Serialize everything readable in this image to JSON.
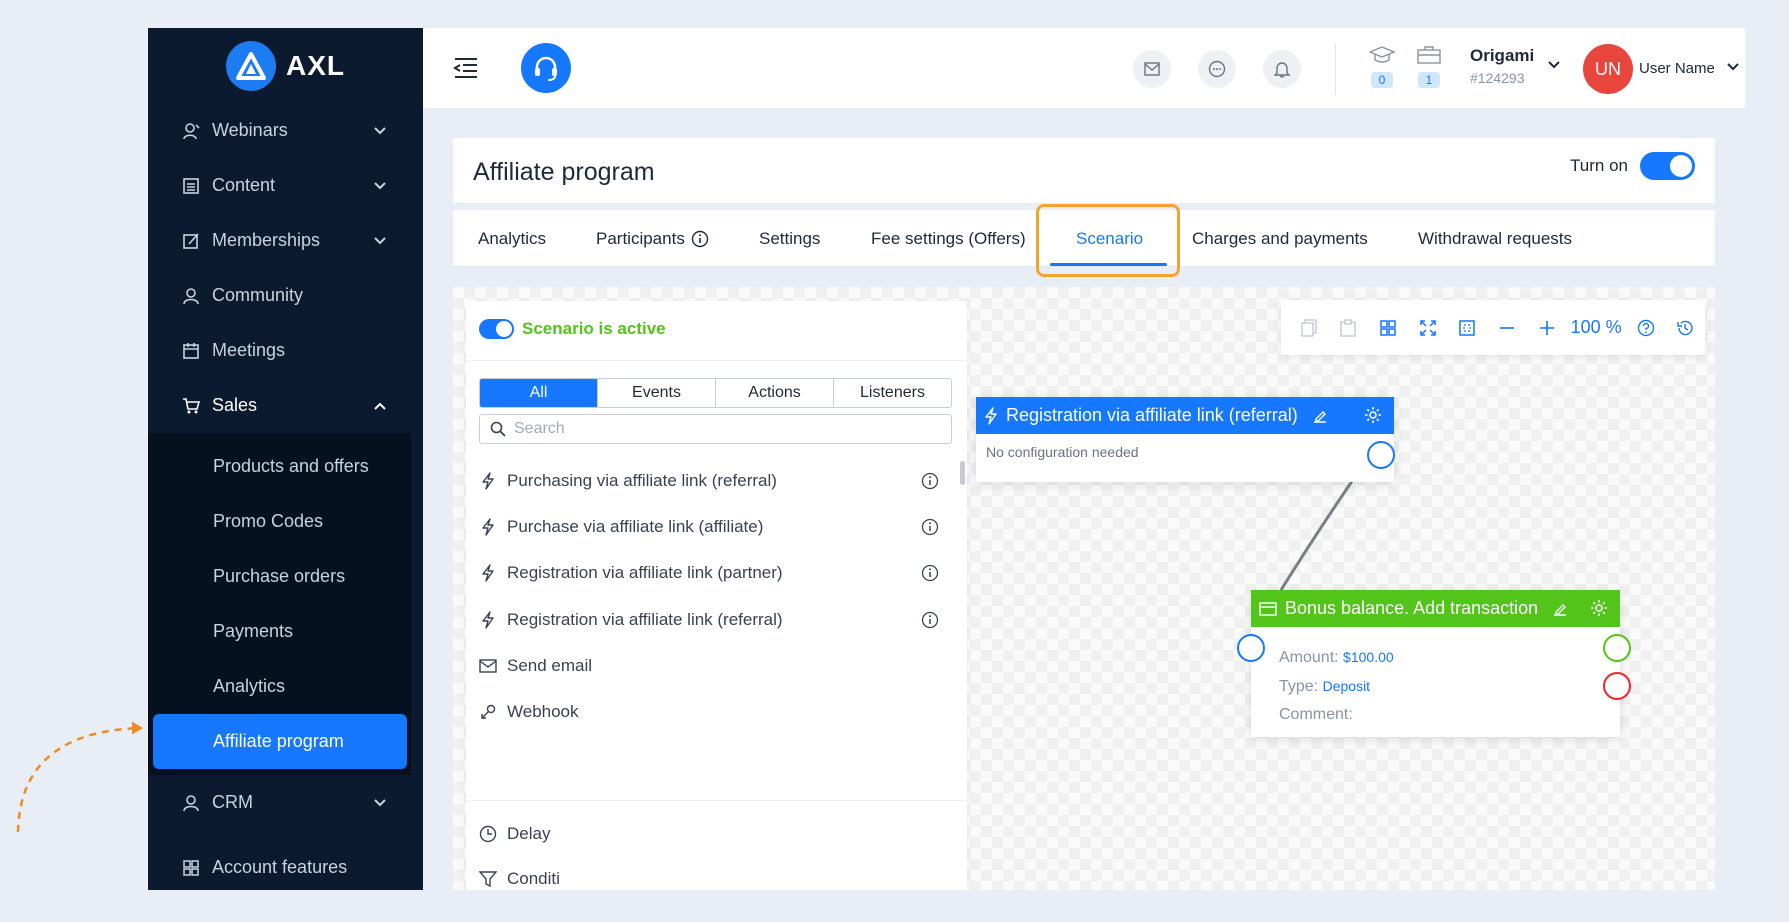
{
  "brand": {
    "name": "AXL",
    "accent": "#1677ff",
    "sidebar_bg": "#0b1a2e"
  },
  "sidebar": {
    "items": [
      {
        "label": "Webinars",
        "icon": "webinar-icon",
        "expandable": true
      },
      {
        "label": "Content",
        "icon": "content-icon",
        "expandable": true
      },
      {
        "label": "Memberships",
        "icon": "membership-icon",
        "expandable": true
      },
      {
        "label": "Community",
        "icon": "user-icon",
        "expandable": false
      },
      {
        "label": "Meetings",
        "icon": "calendar-icon",
        "expandable": false
      },
      {
        "label": "Sales",
        "icon": "cart-icon",
        "expandable": true,
        "open": true
      },
      {
        "label": "CRM",
        "icon": "user-icon",
        "expandable": true
      },
      {
        "label": "Account features",
        "icon": "grid-icon",
        "expandable": false
      }
    ],
    "sales_sub": [
      {
        "label": "Products and offers"
      },
      {
        "label": "Promo Codes"
      },
      {
        "label": "Purchase orders"
      },
      {
        "label": "Payments"
      },
      {
        "label": "Analytics"
      },
      {
        "label": "Affiliate program",
        "active": true
      }
    ]
  },
  "topbar": {
    "counters": [
      {
        "icon": "graduation-cap-icon",
        "value": "0"
      },
      {
        "icon": "briefcase-icon",
        "value": "1"
      }
    ],
    "org_name": "Origami",
    "org_id": "#124293",
    "avatar_initials": "UN",
    "user_name": "User Name"
  },
  "page": {
    "title": "Affiliate program",
    "turn_on_label": "Turn on",
    "turn_on_state": true
  },
  "tabs": [
    {
      "label": "Analytics"
    },
    {
      "label": "Participants"
    },
    {
      "label": "Settings"
    },
    {
      "label": "Fee settings (Offers)"
    },
    {
      "label": "Scenario",
      "active": true
    },
    {
      "label": "Charges and payments"
    },
    {
      "label": "Withdrawal requests"
    }
  ],
  "panel": {
    "status_label": "Scenario is active",
    "filters": [
      {
        "label": "All",
        "active": true
      },
      {
        "label": "Events"
      },
      {
        "label": "Actions"
      },
      {
        "label": "Listeners"
      }
    ],
    "search_placeholder": "Search",
    "items": [
      {
        "label": "Purchasing via affiliate link (referral)",
        "icon": "lightning-icon",
        "info": true
      },
      {
        "label": "Purchase via affiliate link (affiliate)",
        "icon": "lightning-icon",
        "info": true
      },
      {
        "label": "Registration via affiliate link (partner)",
        "icon": "lightning-icon",
        "info": true
      },
      {
        "label": "Registration via affiliate link (referral)",
        "icon": "lightning-icon",
        "info": true
      },
      {
        "label": "Send email",
        "icon": "mail-icon",
        "info": false
      },
      {
        "label": "Webhook",
        "icon": "webhook-icon",
        "info": false
      },
      {
        "label": "Delay",
        "icon": "clock-icon",
        "info": false
      },
      {
        "label": "Conditi",
        "icon": "filter-icon",
        "info": false
      }
    ]
  },
  "toolbar": {
    "zoom": "100 %"
  },
  "nodes": {
    "trigger": {
      "title": "Registration via affiliate link (referral)",
      "body": "No configuration needed",
      "color": "#1677ff"
    },
    "action": {
      "title": "Bonus balance. Add transaction",
      "color": "#52c41a",
      "amount_label": "Amount:",
      "amount_value": "$100.00",
      "type_label": "Type:",
      "type_value": "Deposit",
      "comment_label": "Comment:"
    }
  }
}
